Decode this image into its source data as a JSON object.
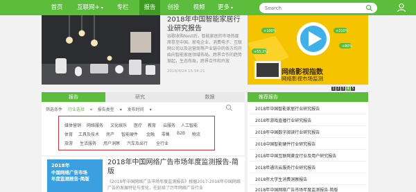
{
  "nav": {
    "items": [
      "首页",
      "互联网+",
      "专栏",
      "报告",
      "创投",
      "视频",
      "更多"
    ],
    "active_index": 3,
    "search_placeholder": "Search"
  },
  "hero": {
    "title": "2018年中国智能家居行业研究报告",
    "desc": "谷歌收购Nest后，智能家居的市场热度席卷至中国，家电企业、消费电子、互联网公司以及运营商等产业链中的各方均开始向智能家居领域布局。跨界合作的趋势渐起，生态布局，跨界合作和开放",
    "date": "2018/4/24 15:34:21"
  },
  "ad": {
    "title": "网络影视指数",
    "subtitle": "网络影视市场监测",
    "pct_labels": [
      "+100%",
      "+210%",
      "+80%",
      "+55.2%"
    ],
    "dots": [
      "1",
      "2",
      "3",
      "4",
      "5"
    ],
    "active_dot": 3
  },
  "tabs": [
    "报告",
    "研究",
    "数据"
  ],
  "filters": {
    "label": "筛选条件",
    "items": [
      "行业选择",
      "报告类型",
      "发布时间"
    ],
    "selected_index": 0
  },
  "tags": [
    [
      "媒体营销",
      "网络服务",
      "文化娱乐",
      "医疗",
      "教育",
      "云服务",
      "人工智能"
    ],
    [
      "体育",
      "工具及技术",
      "房产",
      "智能硬件",
      "金融",
      "零售",
      "B2B",
      "物流"
    ],
    [
      "旅游",
      "生活服务",
      "用户洞察",
      "汽车及出行",
      "全行业"
    ]
  ],
  "article": {
    "title": "2018年中国网络广告市场年度监测报告-简版",
    "desc": "《2018年中国网络广告市场年度监测报告》根据2017-2018年中国网络广告的发展特征与变化，在延续了历年网络广告行业",
    "thumb": [
      "2018年",
      "中国网络广告市场",
      "年度监测报告-简版"
    ]
  },
  "sidebar": {
    "header": "推荐报告",
    "items": [
      "2018年中国智能家居行业研究报告",
      "2018年游戏直播行业研究报告",
      "2018年中国数字阅读行业研究报告",
      "2018中国智能硬件行业研究报告",
      "2018年中国互联网黄金行业及用户研究报告",
      "2018年通讯云服务行业研究报告",
      "2018年大学生消费洞察报告",
      "2018年中国网络广告市场年度监测报告-简版"
    ]
  }
}
